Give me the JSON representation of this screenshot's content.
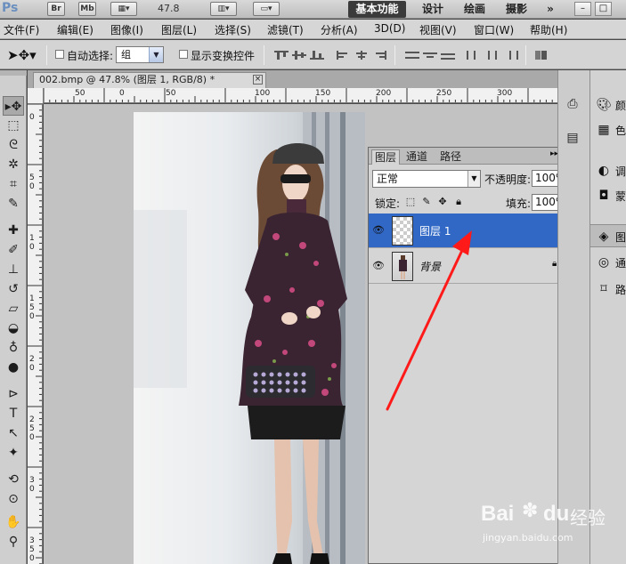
{
  "app": {
    "logo": "Ps",
    "chips": [
      "Br",
      "Mb"
    ],
    "zoom": "47.8",
    "workspaces": [
      "基本功能",
      "设计",
      "绘画",
      "摄影",
      "»"
    ],
    "active_workspace": "基本功能",
    "window_controls": [
      "–",
      "□"
    ]
  },
  "menubar": {
    "items": [
      "文件(F)",
      "编辑(E)",
      "图像(I)",
      "图层(L)",
      "选择(S)",
      "滤镜(T)",
      "分析(A)",
      "3D(D)",
      "视图(V)",
      "窗口(W)",
      "帮助(H)"
    ]
  },
  "options": {
    "auto_select_label": "自动选择:",
    "auto_select_value": "组",
    "show_transform_label": "显示变换控件"
  },
  "tools": {
    "icons": [
      "move-tool-icon",
      "marquee-tool-icon",
      "lasso-tool-icon",
      "quick-select-tool-icon",
      "crop-tool-icon",
      "eyedropper-tool-icon",
      "healing-brush-icon",
      "brush-tool-icon",
      "clone-stamp-icon",
      "history-brush-icon",
      "eraser-tool-icon",
      "paint-bucket-icon",
      "blur-tool-icon",
      "dodge-tool-icon",
      "pen-tool-icon",
      "type-tool-icon",
      "path-select-icon",
      "shape-tool-icon",
      "3d-rotate-icon",
      "3d-orbit-icon",
      "hand-tool-icon",
      "zoom-tool-icon"
    ]
  },
  "document": {
    "tab_title": "002.bmp @ 47.8% (图层 1, RGB/8) *",
    "close": "×",
    "ruler_top": [
      "50",
      "0",
      "50",
      "100",
      "150",
      "200",
      "250",
      "300"
    ],
    "ruler_left": [
      "0",
      "5",
      "0",
      "1",
      "0",
      "1",
      "5",
      "0",
      "2",
      "0",
      "2",
      "5",
      "0",
      "3",
      "0",
      "3",
      "5",
      "0"
    ]
  },
  "layers_panel": {
    "tabs": [
      "图层",
      "通道",
      "路径"
    ],
    "menu": "▸▸ ▾≡",
    "blend_mode": "正常",
    "opacity_label": "不透明度:",
    "opacity_value": "100%",
    "lock_label": "锁定:",
    "fill_label": "填充:",
    "fill_value": "100%",
    "layers": [
      {
        "name": "图层 1",
        "selected": true
      },
      {
        "name": "背景",
        "locked": true
      }
    ]
  },
  "dock": {
    "panel_items": [
      "颜",
      "色",
      "调",
      "蒙",
      "图",
      "通",
      "路"
    ]
  },
  "watermark": {
    "brand": "Bai",
    "paw": "du",
    "cn": "经验",
    "url": "jingyan.baidu.com"
  },
  "colors": {
    "selection_blue": "#3168c6",
    "annotation_arrow": "#ff1a1a"
  }
}
